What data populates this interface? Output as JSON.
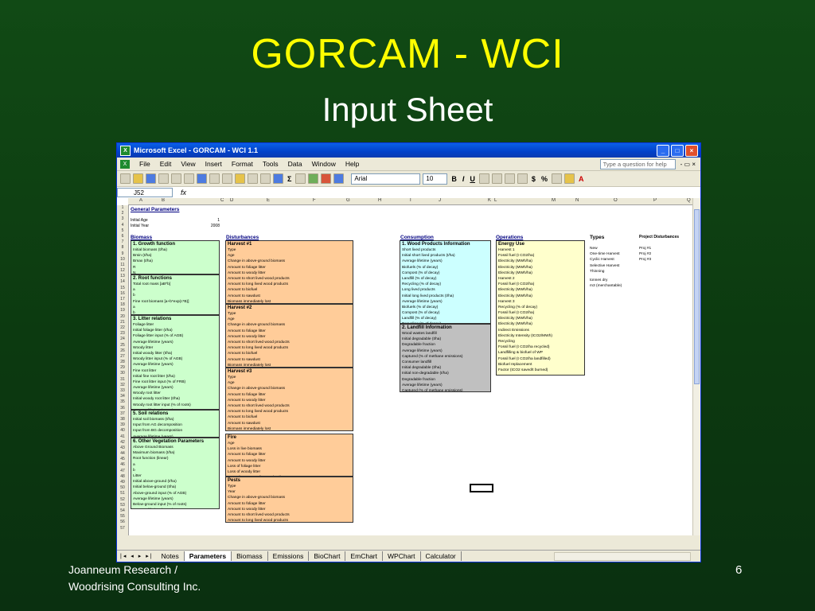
{
  "slide": {
    "title": "GORCAM - WCI",
    "subtitle": "Input Sheet",
    "footer_line1": "Joanneum Research /",
    "footer_line2": "Woodrising Consulting Inc.",
    "page_number": "6"
  },
  "excel": {
    "window_title": "Microsoft Excel - GORCAM - WCI 1.1",
    "menu": [
      "File",
      "Edit",
      "View",
      "Insert",
      "Format",
      "Tools",
      "Data",
      "Window",
      "Help"
    ],
    "help_placeholder": "Type a question for help",
    "font_name": "Arial",
    "font_size": "10",
    "name_box": "J52",
    "fx_label": "fx",
    "columns": [
      "A",
      "B",
      "C",
      "D",
      "E",
      "F",
      "G",
      "H",
      "I",
      "J",
      "K",
      "L",
      "M",
      "N",
      "O",
      "P",
      "Q"
    ],
    "sheet_tabs": [
      "Notes",
      "Parameters",
      "Biomass",
      "Emissions",
      "BioChart",
      "EmChart",
      "WPChart",
      "Calculator"
    ],
    "active_tab": "Parameters",
    "sections": {
      "general": "General Parameters",
      "biomass": "Biomass",
      "disturbances": "Disturbances",
      "consumption": "Consumption",
      "operations": "Operations",
      "types": "Types",
      "project_disturbances": "Project Disturbances"
    },
    "general_rows": [
      {
        "label": "Initial Age",
        "value": "1"
      },
      {
        "label": "Initial Year",
        "value": "2008"
      }
    ],
    "biomass_panels": [
      {
        "title": "1. Growth function",
        "rows": [
          "Initial biomass (t/ha)",
          "Bmin (t/ha)",
          "Bmax (t/ha)",
          "R",
          "N"
        ]
      },
      {
        "title": "2. Root functions",
        "rows": [
          "Total root mass [aB^b]",
          "a",
          "b",
          "Fine root biomass [a+b*exp(c*B)]",
          "a",
          "b",
          "c"
        ]
      },
      {
        "title": "3. Litter relations",
        "rows": [
          "Foliage litter",
          "Initial foliage litter (t/ha)",
          "Foliage litter input (% of AGB)",
          "Average lifetime (years)",
          "Woody litter",
          "Initial woody litter (t/ha)",
          "Woody litter input (% of AGB)",
          "Average lifetime (years)",
          "Fine root litter",
          "Initial fine root litter (t/ha)",
          "Fine root litter input (% of FRB)",
          "Average lifetime (years)",
          "Woody root litter",
          "Initial woody root litter (t/ha)",
          "Woody root litter input (% of roots)",
          "Average lifetime (years)"
        ]
      },
      {
        "title": "5. Soil relations",
        "rows": [
          "Initial soil biomass (t/ha)",
          "Input from AG decomposition",
          "Input from BG decomposition",
          "Average lifetime (years)"
        ]
      },
      {
        "title": "6. Other Vegetation Parameters",
        "rows": [
          "Above Ground Biomass",
          "Maximum biomass (t/ha)",
          "Root function (linear)",
          "a",
          "b",
          "Litter",
          "Initial above-ground (t/ha)",
          "Initial below-ground (t/ha)",
          "Above-ground input (% of AGB)",
          "Average lifetime (years)",
          "Below-ground input (% of roots)",
          "Average lifetime (years)"
        ]
      }
    ],
    "disturbance_panels": [
      {
        "title": "Harvest #1",
        "rows": [
          "Type",
          "Age",
          "Change in above-ground biomass",
          "Amount to foliage litter",
          "Amount to woody litter",
          "Amount to short lived wood products",
          "Amount to long lived wood products",
          "Amount to biofuel",
          "Amount to sawdust",
          "Biomass immediately lost",
          "Total change in biomass"
        ]
      },
      {
        "title": "Harvest #2",
        "rows": [
          "Type",
          "Age",
          "Change in above-ground biomass",
          "Amount to foliage litter",
          "Amount to woody litter",
          "Amount to short lived wood products",
          "Amount to long lived wood products",
          "Amount to biofuel",
          "Amount to sawdust",
          "Biomass immediately lost",
          "Total change in biomass"
        ]
      },
      {
        "title": "Harvest #3",
        "rows": [
          "Type",
          "Age",
          "Change in above-ground biomass",
          "Amount to foliage litter",
          "Amount to woody litter",
          "Amount to short lived wood products",
          "Amount to long lived wood products",
          "Amount to biofuel",
          "Amount to sawdust",
          "Biomass immediately lost",
          "Total change in biomass"
        ]
      },
      {
        "title": "Fire",
        "rows": [
          "Age",
          "Loss in live biomass",
          "Amount to foliage litter",
          "Amount to woody litter",
          "Loss of foliage litter",
          "Loss of woody litter",
          "Loss of roots, root litter and soil"
        ]
      },
      {
        "title": "Pests",
        "rows": [
          "Type",
          "Year",
          "Change in above-ground biomass",
          "Amount to foliage litter",
          "Amount to woody litter",
          "Amount to short lived wood products",
          "Amount to long lived wood products",
          "Amount to biofuel",
          "Amount to sawdust",
          "Biomass immediately lost",
          "Total change in biomass"
        ]
      }
    ],
    "consumption_panels": [
      {
        "title": "1. Wood Products Information",
        "rows": [
          "Short lived products",
          "Initial short lived products (t/ha)",
          "Average lifetime (years)",
          "Biofuels (% of decay)",
          "Compost (% of decay)",
          "Landfill (% of decay)",
          "Recycling (% of decay)",
          "Long lived products",
          "Initial long lived products (t/ha)",
          "Average lifetime (years)",
          "Biofuels (% of decay)",
          "Compost (% of decay)",
          "Landfill (% of decay)",
          "Recycling (% of decay)"
        ]
      },
      {
        "title": "2. Landfill Information",
        "rows": [
          "Wood wastes landfill",
          "Initial degradable (t/ha)",
          "Degradable fraction",
          "Average lifetime (years)",
          "Captured (% of methane emissions)",
          "Consumer landfill",
          "Initial degradable (t/ha)",
          "Initial non-degradable (t/ha)",
          "Degradable fraction",
          "Average lifetime (years)",
          "Captured (% of methane emissions)"
        ]
      }
    ],
    "operations_panel": {
      "title": "Energy Use",
      "rows": [
        "Harvest 1",
        "Fossil fuel (t CO2/ha)",
        "Electricity (MWh/ha)",
        "Electricity (MWh/ha)",
        "Electricity (MWh/ha)",
        "Harvest 2",
        "Fossil fuel (t CO2/ha)",
        "Electricity (MWh/ha)",
        "Electricity (MWh/ha)",
        "Harvest 3",
        "Recycling (% of decay)",
        "Fossil fuel (t CO2/ha)",
        "Electricity (MWh/ha)",
        "Electricity (MWh/ha)",
        "Indirect Emissions",
        "Electricity Intensity (tCO2/MWh)",
        "Recycling",
        "Fossil fuel (t CO2/ha recycled)",
        "Landfilling & biofuel of WP",
        "Fossil fuel (t CO2/ha landfilled)",
        "Biofuel replacement",
        "Factor (tCO2 saved/t burned)"
      ]
    },
    "types_list": [
      "New",
      "One-time Harvest",
      "Cyclic Harvest",
      "Selective Harvest",
      "Thinning"
    ],
    "units_list": [
      "tonnes dry",
      "m3 (merchantable)"
    ],
    "project_list": [
      "Proj #1",
      "Proj #2",
      "Proj #3"
    ]
  }
}
